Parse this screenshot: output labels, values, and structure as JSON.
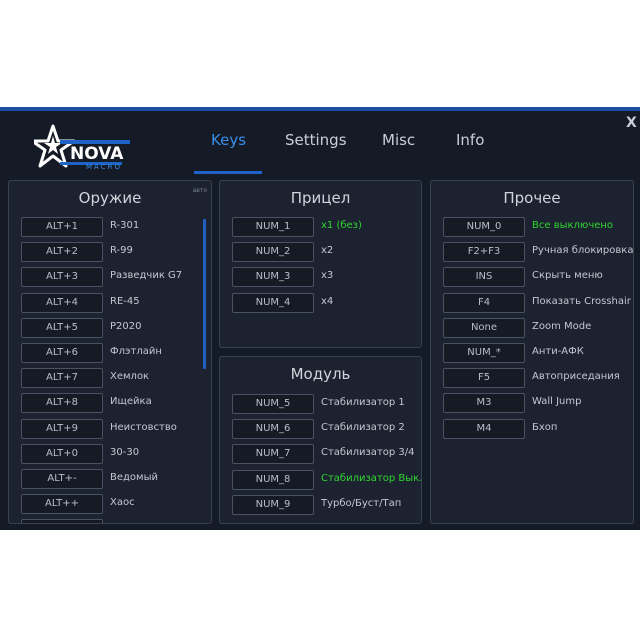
{
  "app": {
    "logo_text": "NOVA",
    "logo_sub": "MACRO"
  },
  "nav": {
    "tabs": [
      {
        "label": "Keys",
        "active": true
      },
      {
        "label": "Settings",
        "active": false
      },
      {
        "label": "Misc",
        "active": false
      },
      {
        "label": "Info",
        "active": false
      }
    ],
    "close_label": "X"
  },
  "panels": {
    "weapons": {
      "title": "Оружие",
      "tag": "авто",
      "rows": [
        {
          "key": "ALT+1",
          "label": "R-301"
        },
        {
          "key": "ALT+2",
          "label": "R-99"
        },
        {
          "key": "ALT+3",
          "label": "Разведчик G7"
        },
        {
          "key": "ALT+4",
          "label": "RE-45"
        },
        {
          "key": "ALT+5",
          "label": "P2020"
        },
        {
          "key": "ALT+6",
          "label": "Флэтлайн"
        },
        {
          "key": "ALT+7",
          "label": "Хемлок"
        },
        {
          "key": "ALT+8",
          "label": "Ищейка"
        },
        {
          "key": "ALT+9",
          "label": "Неистовство"
        },
        {
          "key": "ALT+0",
          "label": "30-30"
        },
        {
          "key": "ALT+-",
          "label": "Ведомый"
        },
        {
          "key": "ALT++",
          "label": "Хаос"
        },
        {
          "key": "",
          "label": ""
        }
      ]
    },
    "sight": {
      "title": "Прицел",
      "rows": [
        {
          "key": "NUM_1",
          "label": "x1 (без)",
          "highlight": true
        },
        {
          "key": "NUM_2",
          "label": "x2"
        },
        {
          "key": "NUM_3",
          "label": "x3"
        },
        {
          "key": "NUM_4",
          "label": "x4"
        }
      ]
    },
    "module": {
      "title": "Модуль",
      "rows": [
        {
          "key": "NUM_5",
          "label": "Стабилизатор 1"
        },
        {
          "key": "NUM_6",
          "label": "Стабилизатор 2"
        },
        {
          "key": "NUM_7",
          "label": "Стабилизатор 3/4"
        },
        {
          "key": "NUM_8",
          "label": "Стабилизатор Выкл.",
          "highlight": true
        },
        {
          "key": "NUM_9",
          "label": "Турбо/Буст/Тап"
        }
      ]
    },
    "other": {
      "title": "Прочее",
      "rows": [
        {
          "key": "NUM_0",
          "label": "Все выключено",
          "highlight": true
        },
        {
          "key": "F2+F3",
          "label": "Ручная блокировка"
        },
        {
          "key": "INS",
          "label": "Скрыть меню"
        },
        {
          "key": "F4",
          "label": "Показать Crosshair"
        },
        {
          "key": "None",
          "label": "Zoom Mode"
        },
        {
          "key": "NUM_*",
          "label": "Анти-АФК"
        },
        {
          "key": "F5",
          "label": "Автоприседания"
        },
        {
          "key": "M3",
          "label": "Wall Jump"
        },
        {
          "key": "M4",
          "label": "Бхоп"
        }
      ]
    }
  },
  "colors": {
    "background": "#151b26",
    "panel": "#1c2230",
    "accent_blue": "#1e63c8",
    "active_tab": "#3a8ee8",
    "highlight_green": "#2fd62f"
  }
}
